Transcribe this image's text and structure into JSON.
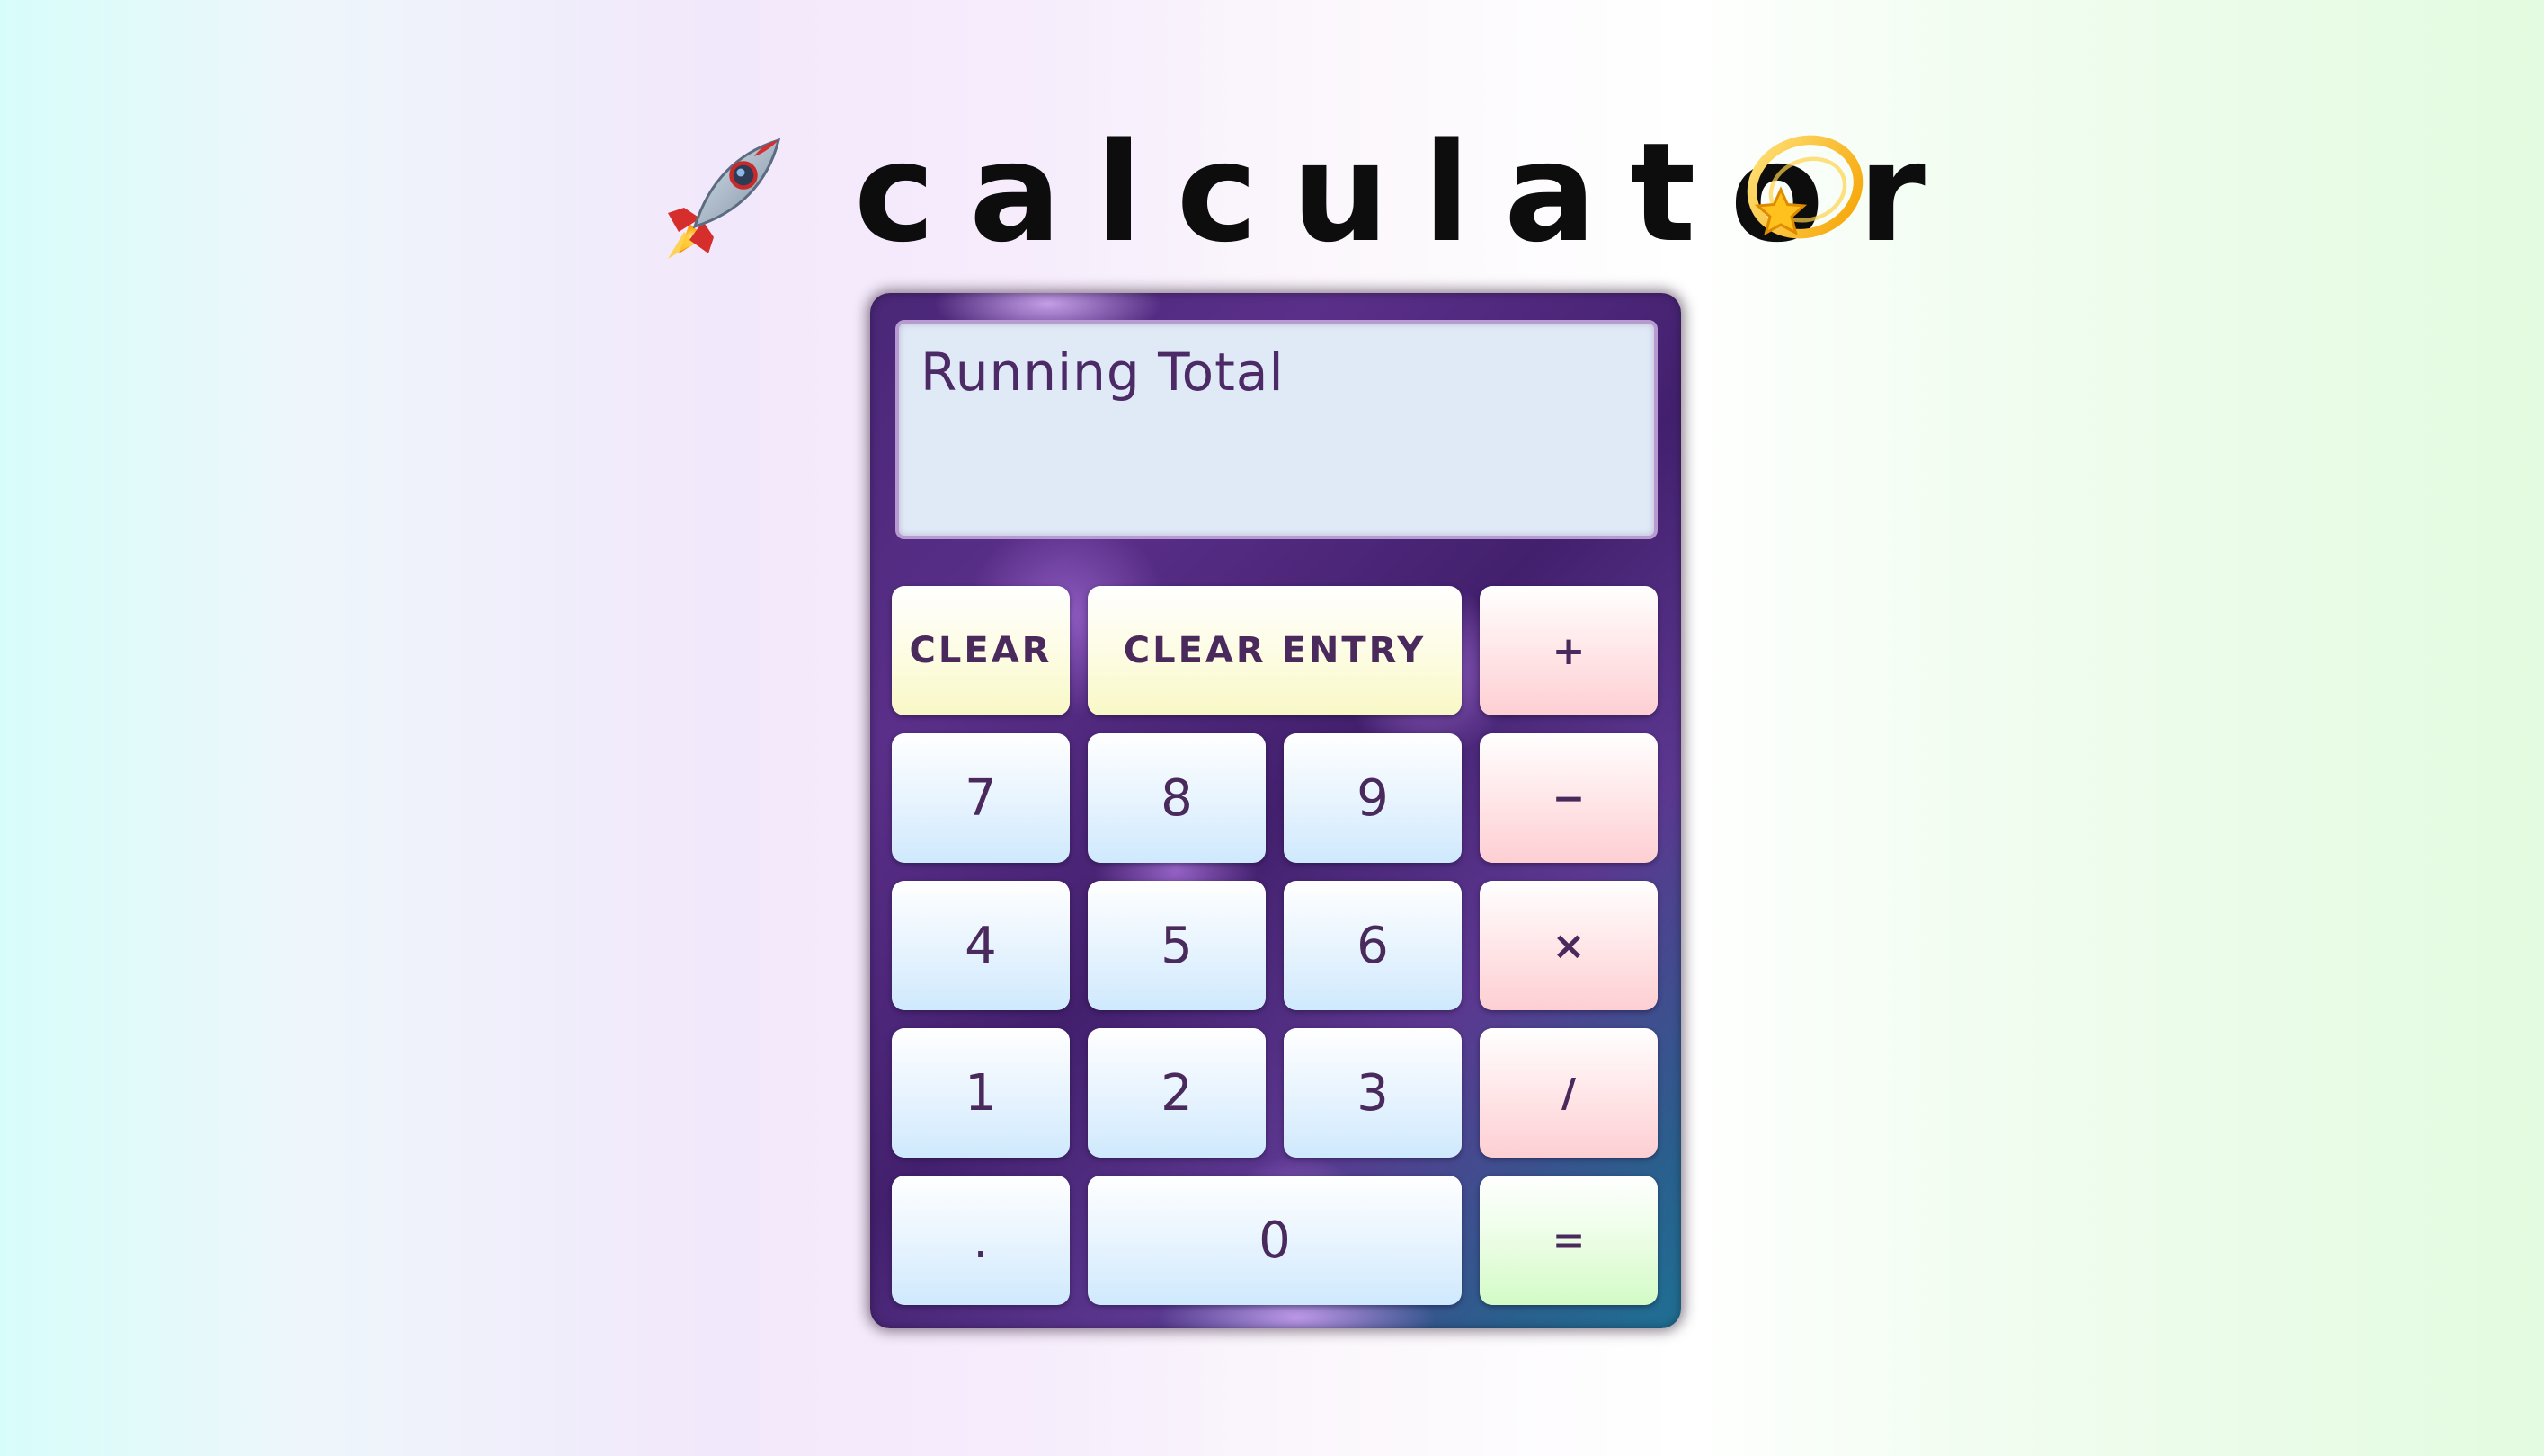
{
  "header": {
    "title": "calculator",
    "left_icon": "rocket-icon",
    "right_icon": "dizzy-star-icon"
  },
  "display": {
    "text": "Running Total"
  },
  "keys": {
    "clear": "CLEAR",
    "clear_entry": "CLEAR ENTRY",
    "plus": "+",
    "seven": "7",
    "eight": "8",
    "nine": "9",
    "minus": "−",
    "four": "4",
    "five": "5",
    "six": "6",
    "times": "×",
    "one": "1",
    "two": "2",
    "three": "3",
    "divide": "/",
    "decimal": ".",
    "zero": "0",
    "equals": "="
  },
  "colors": {
    "number_key": "#cfe9fd",
    "operator_key": "#fdcfd3",
    "clear_key": "#f8f8c6",
    "equals_key": "#d3fbc6",
    "display_bg": "#e0eaf7",
    "body_purple": "#4a2777",
    "text_dark_purple": "#4a2a5c"
  }
}
